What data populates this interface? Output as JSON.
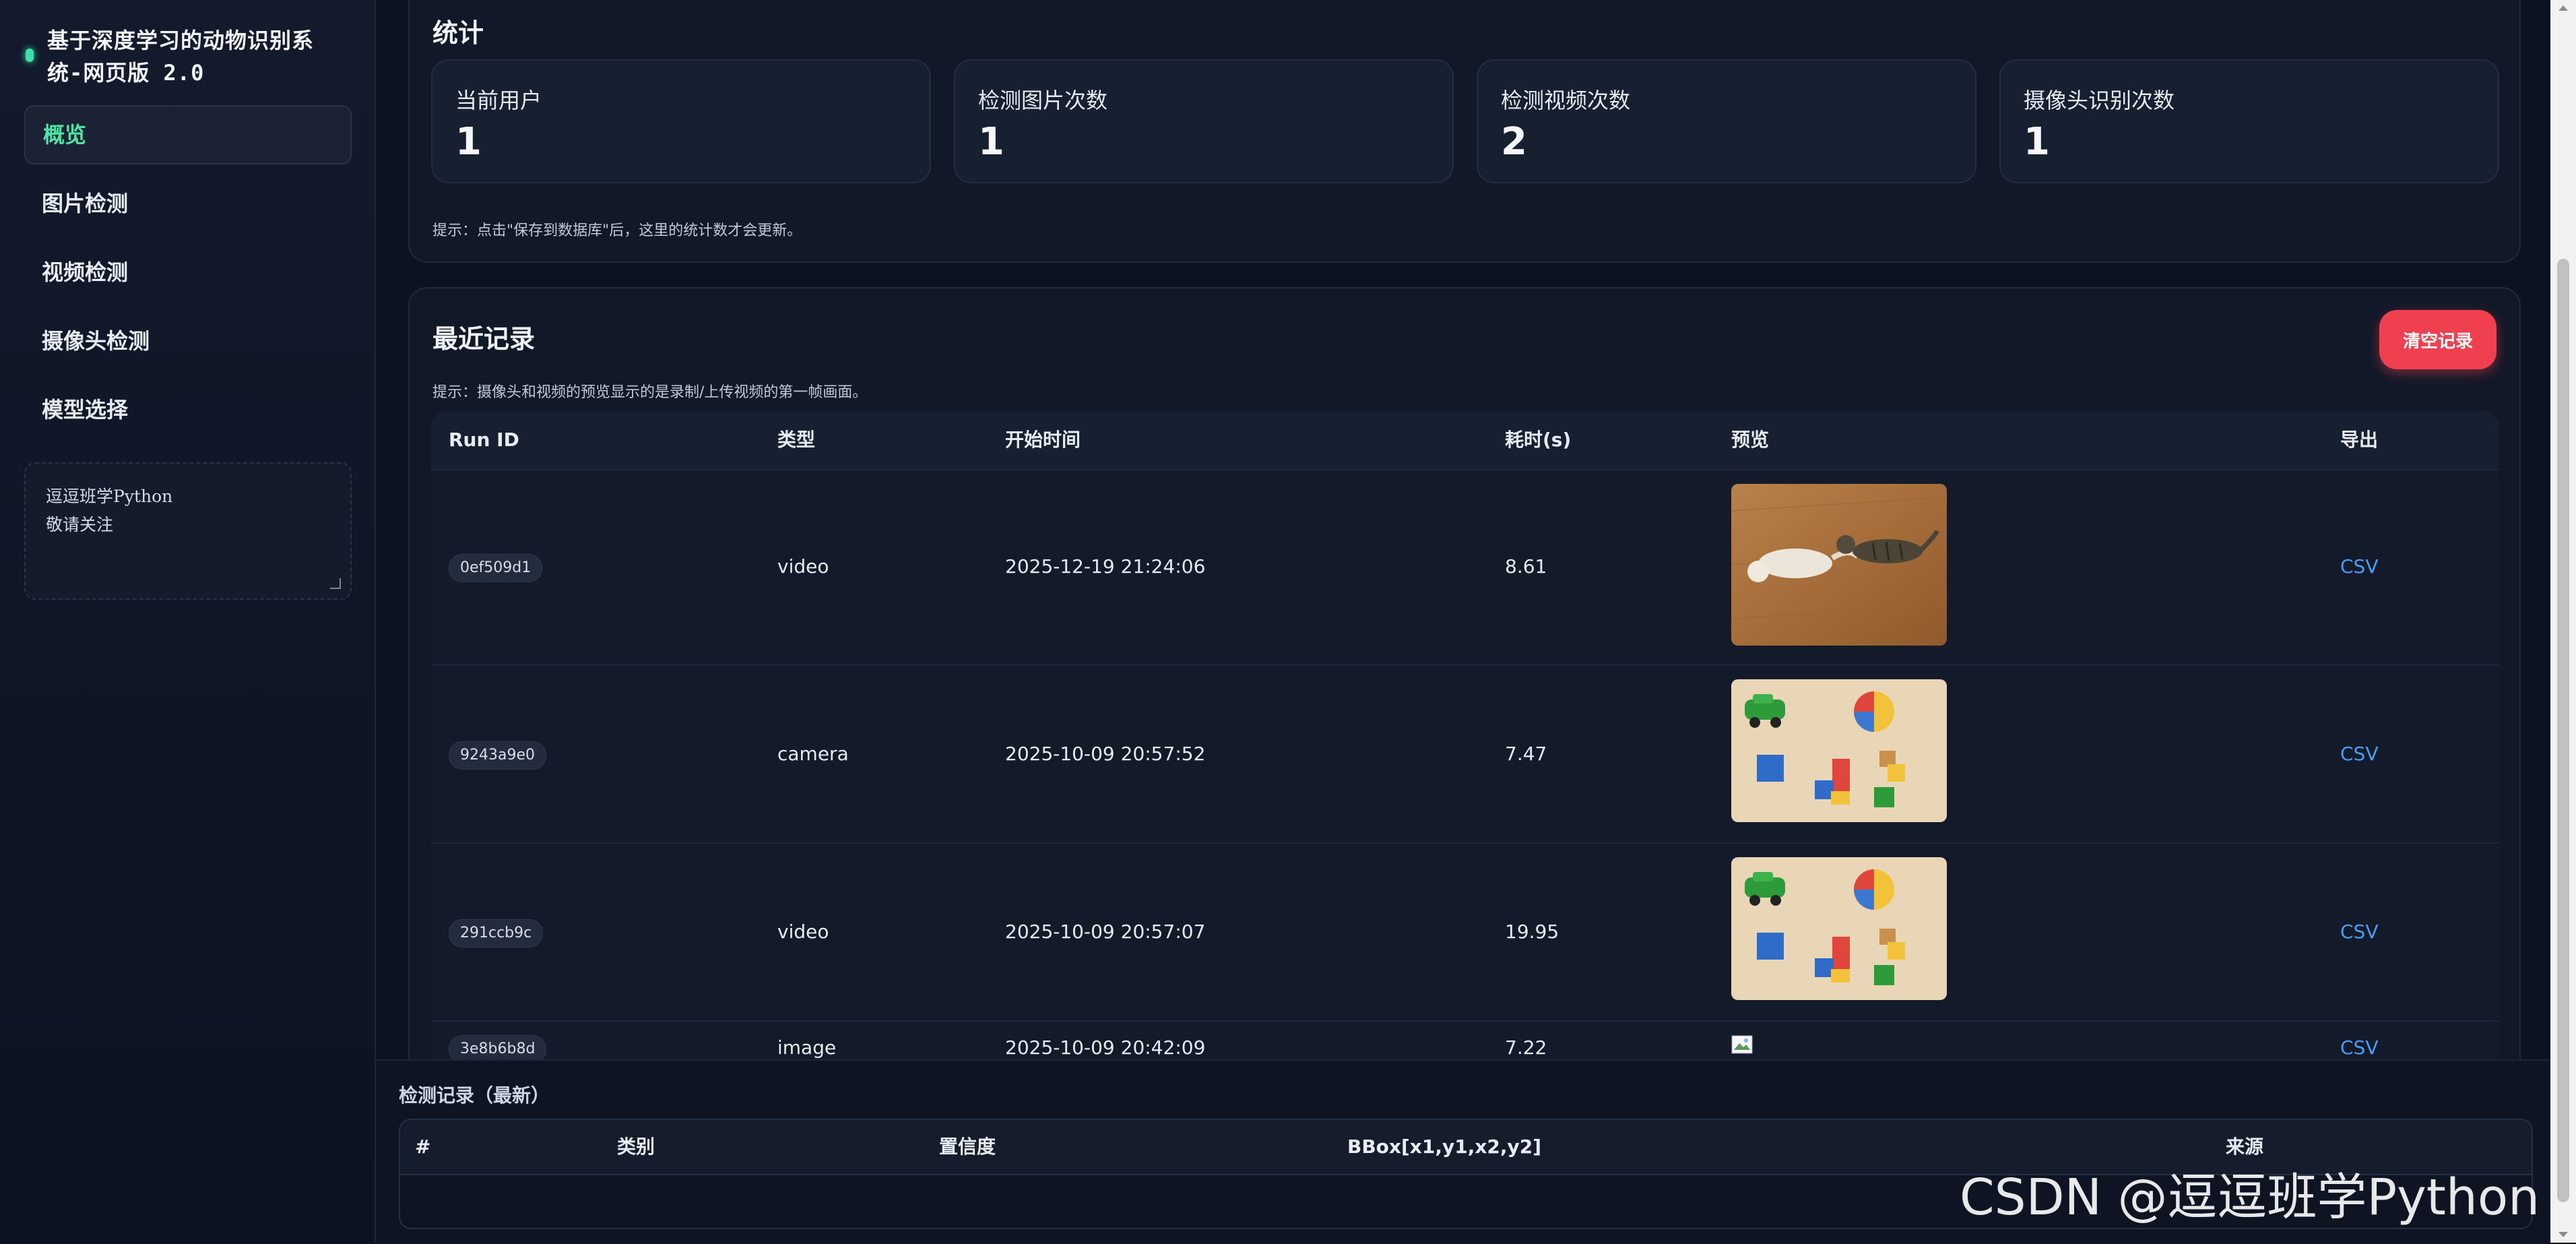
{
  "sidebar": {
    "title": "基于深度学习的动物识别系统-网页版 2.0",
    "nav": [
      {
        "label": "概览",
        "active": true
      },
      {
        "label": "图片检测",
        "active": false
      },
      {
        "label": "视频检测",
        "active": false
      },
      {
        "label": "摄像头检测",
        "active": false
      },
      {
        "label": "模型选择",
        "active": false
      }
    ],
    "note_lines": [
      "逗逗班学Python",
      "敬请关注"
    ]
  },
  "stats": {
    "title": "统计",
    "cards": [
      {
        "label": "当前用户",
        "value": "1"
      },
      {
        "label": "检测图片次数",
        "value": "1"
      },
      {
        "label": "检测视频次数",
        "value": "2"
      },
      {
        "label": "摄像头识别次数",
        "value": "1"
      }
    ],
    "tip": "提示：点击\"保存到数据库\"后，这里的统计数才会更新。"
  },
  "records": {
    "title": "最近记录",
    "clear_label": "清空记录",
    "tip": "提示：摄像头和视频的预览显示的是录制/上传视频的第一帧画面。",
    "columns": [
      "Run ID",
      "类型",
      "开始时间",
      "耗时(s)",
      "预览",
      "导出"
    ],
    "rows": [
      {
        "run_id": "0ef509d1",
        "type": "video",
        "start": "2025-12-19 21:24:06",
        "duration": "8.61",
        "preview": "cats",
        "export": "CSV"
      },
      {
        "run_id": "9243a9e0",
        "type": "camera",
        "start": "2025-10-09 20:57:52",
        "duration": "7.47",
        "preview": "toys",
        "export": "CSV"
      },
      {
        "run_id": "291ccb9c",
        "type": "video",
        "start": "2025-10-09 20:57:07",
        "duration": "19.95",
        "preview": "toys",
        "export": "CSV"
      },
      {
        "run_id": "3e8b6b8d",
        "type": "image",
        "start": "2025-10-09 20:42:09",
        "duration": "7.22",
        "preview": "broken",
        "export": "CSV"
      }
    ]
  },
  "detections": {
    "title": "检测记录（最新）",
    "columns": [
      "#",
      "类别",
      "置信度",
      "BBox[x1,y1,x2,y2]",
      "来源"
    ]
  },
  "watermark": "CSDN @逗逗班学Python",
  "colors": {
    "accent": "#3fe0a6",
    "danger": "#f0404f",
    "link": "#4a9df3",
    "background": "#0d1220"
  }
}
